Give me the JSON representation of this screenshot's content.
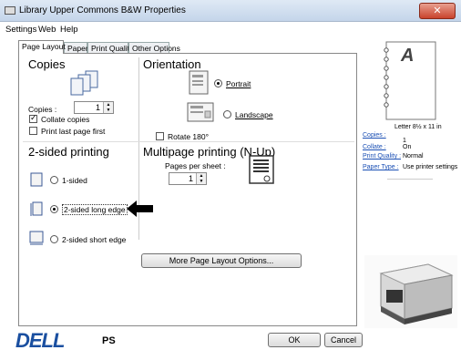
{
  "window": {
    "title": "Library Upper Commons B&W Properties",
    "close": "✕"
  },
  "menu": {
    "settings": "Settings",
    "web": "Web",
    "help": "Help"
  },
  "tabs": [
    "Page Layout",
    "Paper",
    "Print Quality",
    "Other Options"
  ],
  "copies": {
    "title": "Copies",
    "label": "Copies :",
    "value": "1",
    "collate_label": "Collate copies",
    "print_last_label": "Print last page first"
  },
  "orientation": {
    "title": "Orientation",
    "portrait": "Portrait",
    "landscape": "Landscape",
    "rotate": "Rotate 180°"
  },
  "two_sided": {
    "title": "2-sided printing",
    "one_sided": "1-sided",
    "long_edge": "2-sided long edge",
    "short_edge": "2-sided short edge"
  },
  "multipage": {
    "title": "Multipage printing (N-Up)",
    "pages_label": "Pages per sheet :",
    "pages_value": "1"
  },
  "more_button": "More Page Layout Options...",
  "summary": {
    "paper_size": "Letter 8½ x 11 in",
    "copies_label": "Copies :",
    "copies_value": "1",
    "collate_label": "Collate :",
    "collate_value": "On",
    "quality_label": "Print Quality :",
    "quality_value": "Normal",
    "type_label": "Paper Type :",
    "type_value": "Use printer settings",
    "preview_letter": "A"
  },
  "footer": {
    "brand": "DELL",
    "ps": "PS",
    "ok": "OK",
    "cancel": "Cancel"
  }
}
